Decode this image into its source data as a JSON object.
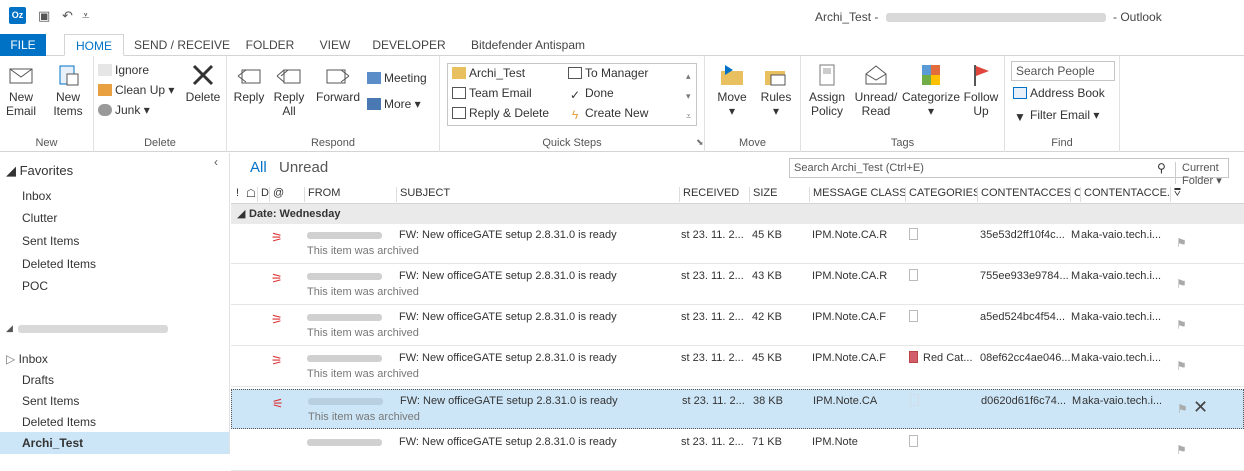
{
  "window": {
    "title_prefix": "Archi_Test - ",
    "title_suffix": " - Outlook",
    "app_icon_label": "Oz",
    "qat_icons": [
      "save-icon",
      "undo-icon",
      "customize-icon"
    ]
  },
  "tabs": [
    "FILE",
    "HOME",
    "SEND / RECEIVE",
    "FOLDER",
    "VIEW",
    "DEVELOPER",
    "Bitdefender Antispam"
  ],
  "ribbon": {
    "new": {
      "label": "New",
      "new_email": "New\nEmail",
      "new_items": "New\nItems"
    },
    "delete": {
      "label": "Delete",
      "ignore": "Ignore",
      "cleanup": "Clean Up",
      "junk": "Junk",
      "delete": "Delete"
    },
    "respond": {
      "label": "Respond",
      "reply": "Reply",
      "reply_all": "Reply\nAll",
      "forward": "Forward",
      "meeting": "Meeting",
      "more": "More"
    },
    "quicksteps": {
      "label": "Quick Steps",
      "items": [
        "Archi_Test",
        "To Manager",
        "Team Email",
        "Done",
        "Reply & Delete",
        "Create New"
      ]
    },
    "move": {
      "label": "Move",
      "move": "Move",
      "rules": "Rules"
    },
    "tags": {
      "label": "Tags",
      "assign_policy": "Assign\nPolicy",
      "unread_read": "Unread/\nRead",
      "categorize": "Categorize",
      "follow_up": "Follow\nUp"
    },
    "find": {
      "label": "Find",
      "search_people": "Search People",
      "address_book": "Address Book",
      "filter_email": "Filter Email"
    }
  },
  "sidebar": {
    "favorites": "Favorites",
    "fav_items": [
      "Inbox",
      "Clutter",
      "Sent Items",
      "Deleted Items",
      "POC"
    ],
    "account_items": [
      "Inbox",
      "Drafts",
      "Sent Items",
      "Deleted Items",
      "Archi_Test"
    ],
    "selected": "Archi_Test"
  },
  "main": {
    "filter_all": "All",
    "filter_unread": "Unread",
    "search_placeholder": "Search Archi_Test (Ctrl+E)",
    "search_scope": "Current Folder",
    "columns": [
      "!",
      "☖",
      "D",
      "@",
      "FROM",
      "SUBJECT",
      "RECEIVED",
      "SIZE",
      "MESSAGE CLASS",
      "CATEGORIES",
      "CONTENTACCES...",
      "C",
      "CONTENTACCE..."
    ],
    "group_header": "Date: Wednesday",
    "rows": [
      {
        "subject": "FW: New officeGATE setup 2.8.31.0 is ready",
        "preview": "This item was archived",
        "received": "st 23. 11. 2...",
        "size": "45 KB",
        "class": "IPM.Note.CA.R",
        "category": "",
        "content1": "35e53d2ff10f4c...",
        "c": "M",
        "content2": "aka-vaio.tech.i...",
        "selected": false
      },
      {
        "subject": "FW: New officeGATE setup 2.8.31.0 is ready",
        "preview": "This item was archived",
        "received": "st 23. 11. 2...",
        "size": "43 KB",
        "class": "IPM.Note.CA.R",
        "category": "",
        "content1": "755ee933e9784...",
        "c": "M",
        "content2": "aka-vaio.tech.i...",
        "selected": false
      },
      {
        "subject": "FW: New officeGATE setup 2.8.31.0 is ready",
        "preview": "This item was archived",
        "received": "st 23. 11. 2...",
        "size": "42 KB",
        "class": "IPM.Note.CA.F",
        "category": "",
        "content1": "a5ed524bc4f54...",
        "c": "M",
        "content2": "aka-vaio.tech.i...",
        "selected": false
      },
      {
        "subject": "FW: New officeGATE setup 2.8.31.0 is ready",
        "preview": "This item was archived",
        "received": "st 23. 11. 2...",
        "size": "45 KB",
        "class": "IPM.Note.CA.F",
        "category": "Red Cat...",
        "content1": "08ef62cc4ae046...",
        "c": "M",
        "content2": "aka-vaio.tech.i...",
        "selected": false
      },
      {
        "subject": "FW: New officeGATE setup 2.8.31.0 is ready",
        "preview": "This item was archived",
        "received": "st 23. 11. 2...",
        "size": "38 KB",
        "class": "IPM.Note.CA",
        "category": "",
        "content1": "d0620d61f6c74...",
        "c": "M",
        "content2": "aka-vaio.tech.i...",
        "selected": true
      },
      {
        "subject": "FW: New officeGATE setup 2.8.31.0 is ready",
        "preview": "",
        "received": "st 23. 11. 2...",
        "size": "71 KB",
        "class": "IPM.Note",
        "category": "",
        "content1": "",
        "c": "",
        "content2": "",
        "selected": false
      }
    ]
  },
  "colors": {
    "accent": "#0072c6",
    "selection": "#cde6f7"
  }
}
